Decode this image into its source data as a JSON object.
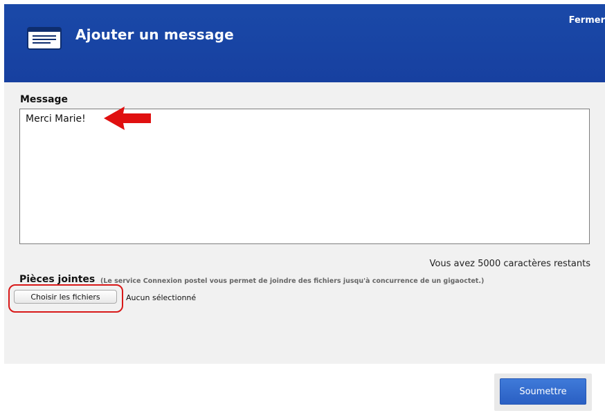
{
  "header": {
    "title": "Ajouter un message",
    "close_label": "Fermer",
    "icon": "message-icon",
    "color": "#1a49a8"
  },
  "message": {
    "label": "Message",
    "value": "Merci Marie!",
    "remaining": "Vous avez 5000 caractères restants"
  },
  "attachments": {
    "title": "Pièces jointes",
    "note": "(Le service Connexion postel vous permet de joindre des fichiers jusqu'à concurrence de un gigaoctet.)",
    "choose_label": "Choisir les fichiers",
    "status": "Aucun sélectionné"
  },
  "actions": {
    "submit_label": "Soumettre"
  },
  "annotations": {
    "arrow_color": "#e01010",
    "ring_color": "#d81818"
  }
}
